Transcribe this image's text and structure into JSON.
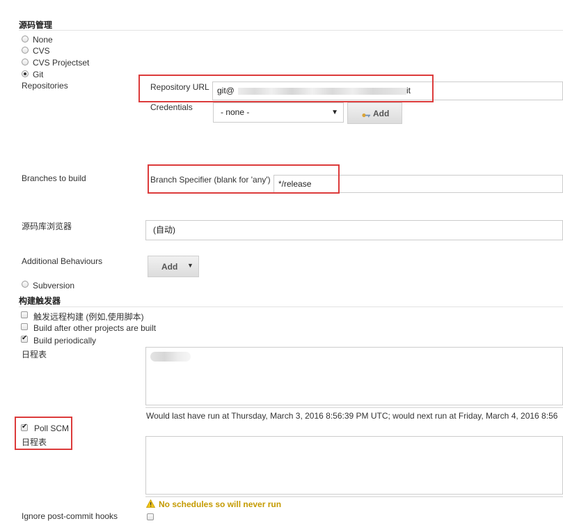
{
  "scm": {
    "title": "源码管理",
    "options": [
      "None",
      "CVS",
      "CVS Projectset",
      "Git",
      "Subversion"
    ],
    "selected": "Git",
    "repositories_label": "Repositories",
    "repository_url_label": "Repository URL",
    "repository_url_prefix": "git@",
    "repository_url_suffix": "it",
    "credentials_label": "Credentials",
    "credentials_value": "- none -",
    "credentials_add_label": "Add",
    "branches_label": "Branches to build",
    "branch_specifier_label": "Branch Specifier (blank for 'any')",
    "branch_specifier_value": "*/release",
    "browser_label": "源码库浏览器",
    "browser_value": "(自动)",
    "additional_behaviours_label": "Additional Behaviours",
    "additional_add_label": "Add"
  },
  "triggers": {
    "title": "构建触发器",
    "options": [
      {
        "label": "触发远程构建 (例如,使用脚本)",
        "checked": false
      },
      {
        "label": "Build after other projects are built",
        "checked": false
      },
      {
        "label": "Build periodically",
        "checked": true
      }
    ],
    "schedule_label": "日程表",
    "periodic_info": "Would last have run at Thursday, March 3, 2016 8:56:39 PM UTC; would next run at Friday, March 4, 2016 8:56",
    "poll_scm_label": "Poll SCM",
    "poll_scm_checked": true,
    "poll_schedule_label": "日程表",
    "warning_text": "No schedules so will never run",
    "ignore_hooks_label": "Ignore post-commit hooks",
    "ignore_hooks_checked": false
  },
  "colors": {
    "highlight": "#dc3b3b",
    "warning": "#c49a00"
  }
}
